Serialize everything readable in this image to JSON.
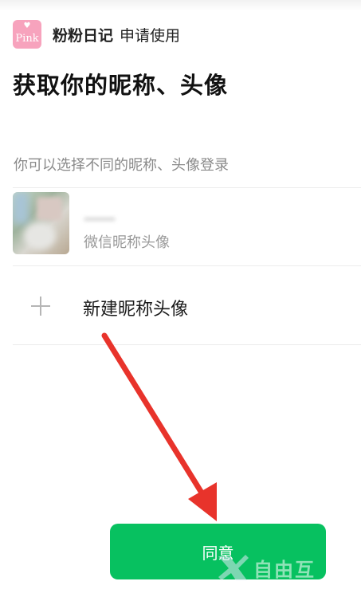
{
  "app": {
    "logo_text": "Pink",
    "name": "粉粉日记",
    "request_label": "申请使用"
  },
  "page": {
    "title": "获取你的昵称、头像",
    "subtitle": "你可以选择不同的昵称、头像登录"
  },
  "options": {
    "wechat_profile": {
      "label": "微信昵称头像"
    },
    "new_profile": {
      "label": "新建昵称头像"
    }
  },
  "actions": {
    "agree_label": "同意"
  },
  "watermark": {
    "text": "自由互"
  },
  "colors": {
    "accent_green": "#07c160",
    "arrow_red": "#e8332b",
    "logo_pink": "#f7a3bd"
  }
}
